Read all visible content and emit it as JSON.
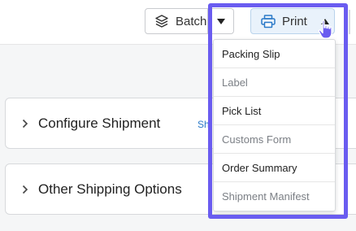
{
  "toolbar": {
    "batch_label": "Batch",
    "print_label": "Print"
  },
  "print_menu": {
    "items": [
      {
        "label": "Packing Slip",
        "enabled": true
      },
      {
        "label": "Label",
        "enabled": false
      },
      {
        "label": "Pick List",
        "enabled": true
      },
      {
        "label": "Customs Form",
        "enabled": false
      },
      {
        "label": "Order Summary",
        "enabled": true
      },
      {
        "label": "Shipment Manifest",
        "enabled": false
      }
    ]
  },
  "panels": {
    "configure_title": "Configure Shipment",
    "configure_link": "Shi",
    "other_title": "Other Shipping Options"
  },
  "colors": {
    "accent": "#2a79c8",
    "highlight": "#6a5cf0",
    "print_bg": "#e9f2fb"
  },
  "icons": {
    "batch": "layers-icon",
    "print": "printer-icon",
    "cursor": "hand-pointer-icon"
  }
}
